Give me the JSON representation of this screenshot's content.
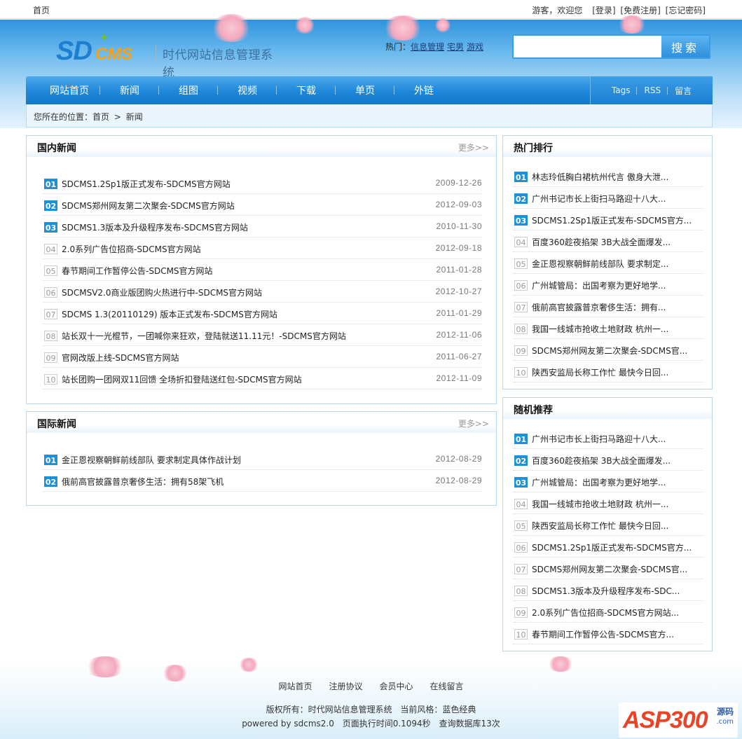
{
  "topbar": {
    "home": "首页",
    "greeting": "游客，欢迎您",
    "login": "[登录]",
    "register": "[免费注册]",
    "forgot": "[忘记密码]"
  },
  "logo": {
    "sd": "SD",
    "cms": "CMS",
    "tagline": "时代网站信息管理系统"
  },
  "hot_links": {
    "label": "热门：",
    "items": [
      "信息管理",
      "宅男",
      "游戏"
    ]
  },
  "search": {
    "value": "",
    "button": "搜索"
  },
  "nav": {
    "items": [
      "网站首页",
      "新闻",
      "组图",
      "视频",
      "下载",
      "单页",
      "外链"
    ],
    "right": [
      "Tags",
      "RSS",
      "留言"
    ]
  },
  "breadcrumb": {
    "label": "您所在的位置：",
    "home": "首页",
    "sep": ">",
    "current": "新闻"
  },
  "domestic": {
    "title": "国内新闻",
    "more": "更多>>",
    "items": [
      {
        "num": "01",
        "title": "SDCMS1.2Sp1版正式发布-SDCMS官方网站",
        "date": "2009-12-26"
      },
      {
        "num": "02",
        "title": "SDCMS郑州网友第二次聚会-SDCMS官方网站",
        "date": "2012-09-03"
      },
      {
        "num": "03",
        "title": "SDCMS1.3版本及升级程序发布-SDCMS官方网站",
        "date": "2010-11-30"
      },
      {
        "num": "04",
        "title": "2.0系列广告位招商-SDCMS官方网站",
        "date": "2012-09-18"
      },
      {
        "num": "05",
        "title": "春节期间工作暂停公告-SDCMS官方网站",
        "date": "2011-01-28"
      },
      {
        "num": "06",
        "title": "SDCMSV2.0商业版团购火热进行中-SDCMS官方网站",
        "date": "2012-10-27"
      },
      {
        "num": "07",
        "title": "SDCMS 1.3(20110129) 版本正式发布-SDCMS官方网站",
        "date": "2011-01-29"
      },
      {
        "num": "08",
        "title": "站长双十一光棍节，一团喊你来狂欢，登陆就送11.11元！-SDCMS官方网站",
        "date": "2012-11-06"
      },
      {
        "num": "09",
        "title": "官网改版上线-SDCMS官方网站",
        "date": "2011-06-27"
      },
      {
        "num": "10",
        "title": "站长团购一团网双11回馈 全场折扣登陆送红包-SDCMS官方网站",
        "date": "2012-11-09"
      }
    ]
  },
  "international": {
    "title": "国际新闻",
    "more": "更多>>",
    "items": [
      {
        "num": "01",
        "title": "金正恩视察朝鲜前线部队 要求制定具体作战计划",
        "date": "2012-08-29"
      },
      {
        "num": "02",
        "title": "俄前高官披露普京奢侈生活：拥有58架飞机",
        "date": "2012-08-29"
      }
    ]
  },
  "hot_rank": {
    "title": "热门排行",
    "items": [
      {
        "num": "01",
        "title": "林志玲低胸白裙杭州代言 傲身大泄..."
      },
      {
        "num": "02",
        "title": "广州书记市长上街扫马路迎十八大..."
      },
      {
        "num": "03",
        "title": "SDCMS1.2Sp1版正式发布-SDCMS官方..."
      },
      {
        "num": "04",
        "title": "百度360趁夜掐架 3B大战全面爆发..."
      },
      {
        "num": "05",
        "title": "金正恩视察朝鲜前线部队 要求制定..."
      },
      {
        "num": "06",
        "title": "广州城管局：出国考察为更好地学..."
      },
      {
        "num": "07",
        "title": "俄前高官披露普京奢侈生活：拥有..."
      },
      {
        "num": "08",
        "title": "我国一线城市抢收土地财政 杭州一..."
      },
      {
        "num": "09",
        "title": "SDCMS郑州网友第二次聚会-SDCMS官..."
      },
      {
        "num": "10",
        "title": "陕西安监局长称工作忙 最快今日回..."
      }
    ]
  },
  "random": {
    "title": "随机推荐",
    "items": [
      {
        "num": "01",
        "title": "广州书记市长上街扫马路迎十八大..."
      },
      {
        "num": "02",
        "title": "百度360趁夜掐架 3B大战全面爆发..."
      },
      {
        "num": "03",
        "title": "广州城管局：出国考察为更好地学..."
      },
      {
        "num": "04",
        "title": "我国一线城市抢收土地财政 杭州一..."
      },
      {
        "num": "05",
        "title": "陕西安监局长称工作忙 最快今日回..."
      },
      {
        "num": "06",
        "title": "SDCMS1.2Sp1版正式发布-SDCMS官方..."
      },
      {
        "num": "07",
        "title": "SDCMS郑州网友第二次聚会-SDCMS官..."
      },
      {
        "num": "08",
        "title": "SDCMS1.3版本及升级程序发布-SDC..."
      },
      {
        "num": "09",
        "title": "2.0系列广告位招商-SDCMS官方网站..."
      },
      {
        "num": "10",
        "title": "春节期间工作暂停公告-SDCMS官方..."
      }
    ]
  },
  "footer": {
    "links": [
      "网站首页",
      "注册协议",
      "会员中心",
      "在线留言"
    ],
    "copyright": "版权所有：时代网站信息管理系统",
    "style": "当前风格：蓝色经典",
    "powered": "powered by sdcms2.0",
    "exec": "页面执行时间0.1094秒",
    "queries": "查询数据库13次"
  },
  "badge": {
    "brand": "ASP300",
    "label": "源码",
    "domain": ".com"
  },
  "colors": {
    "accent": "#1f8fd8",
    "nav_blue": "#1f87d9",
    "border": "#b8d7ee"
  }
}
